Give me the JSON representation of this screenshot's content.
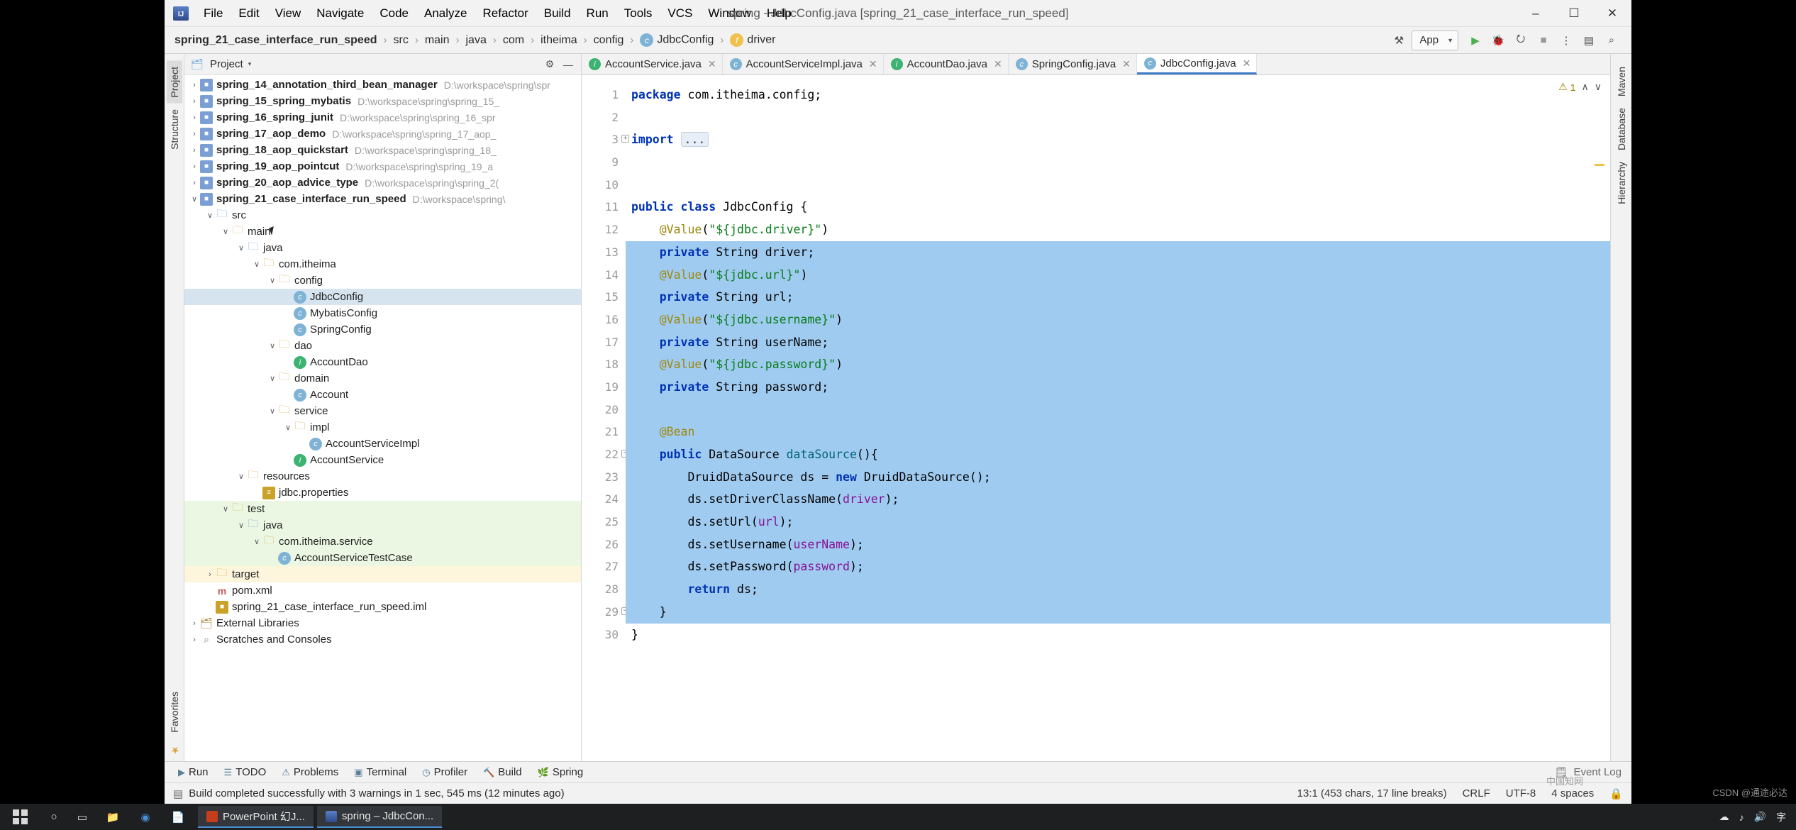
{
  "window": {
    "title": "spring - JdbcConfig.java [spring_21_case_interface_run_speed]",
    "minimize": "–",
    "maximize": "☐",
    "close": "✕"
  },
  "menu": {
    "logo": "IJ",
    "items": [
      "File",
      "Edit",
      "View",
      "Navigate",
      "Code",
      "Analyze",
      "Refactor",
      "Build",
      "Run",
      "Tools",
      "VCS",
      "Window",
      "Help"
    ]
  },
  "breadcrumb": {
    "items": [
      {
        "label": "spring_21_case_interface_run_speed",
        "bold": true,
        "icon": ""
      },
      {
        "label": "src",
        "bold": false,
        "icon": ""
      },
      {
        "label": "main",
        "bold": false,
        "icon": ""
      },
      {
        "label": "java",
        "bold": false,
        "icon": ""
      },
      {
        "label": "com",
        "bold": false,
        "icon": ""
      },
      {
        "label": "itheima",
        "bold": false,
        "icon": ""
      },
      {
        "label": "config",
        "bold": false,
        "icon": ""
      },
      {
        "label": "JdbcConfig",
        "bold": false,
        "icon": "c"
      },
      {
        "label": "driver",
        "bold": false,
        "icon": "f"
      }
    ],
    "separator": "›"
  },
  "toolbar": {
    "build_icon": "⚒",
    "run_config": "App",
    "run_config_caret": "▼",
    "run_icon": "▶",
    "debug_icon": "🐞",
    "coverage_icon": "⭮",
    "stop_icon": "■",
    "more_icon": "⋮",
    "layout_icon": "▤",
    "search_icon": "⌕"
  },
  "project_panel": {
    "header_title": "Project",
    "header_caret": "▾",
    "header_icons": [
      "⚙",
      "—"
    ],
    "tree": [
      {
        "indent": 0,
        "arrow": "›",
        "icon": "mod",
        "icon_char": "■",
        "label": "spring_14_annotation_third_bean_manager",
        "dim": "D:\\workspace\\spring\\spr",
        "bold": true,
        "clipped": true
      },
      {
        "indent": 0,
        "arrow": "›",
        "icon": "mod",
        "icon_char": "■",
        "label": "spring_15_spring_mybatis",
        "dim": "D:\\workspace\\spring\\spring_15_",
        "bold": true
      },
      {
        "indent": 0,
        "arrow": "›",
        "icon": "mod",
        "icon_char": "■",
        "label": "spring_16_spring_junit",
        "dim": "D:\\workspace\\spring\\spring_16_spr",
        "bold": true
      },
      {
        "indent": 0,
        "arrow": "›",
        "icon": "mod",
        "icon_char": "■",
        "label": "spring_17_aop_demo",
        "dim": "D:\\workspace\\spring\\spring_17_aop_",
        "bold": true
      },
      {
        "indent": 0,
        "arrow": "›",
        "icon": "mod",
        "icon_char": "■",
        "label": "spring_18_aop_quickstart",
        "dim": "D:\\workspace\\spring\\spring_18_",
        "bold": true
      },
      {
        "indent": 0,
        "arrow": "›",
        "icon": "mod",
        "icon_char": "■",
        "label": "spring_19_aop_pointcut",
        "dim": "D:\\workspace\\spring\\spring_19_a",
        "bold": true
      },
      {
        "indent": 0,
        "arrow": "›",
        "icon": "mod",
        "icon_char": "■",
        "label": "spring_20_aop_advice_type",
        "dim": "D:\\workspace\\spring\\spring_2(",
        "bold": true
      },
      {
        "indent": 0,
        "arrow": "∨",
        "icon": "mod",
        "icon_char": "■",
        "label": "spring_21_case_interface_run_speed",
        "dim": "D:\\workspace\\spring\\",
        "bold": true
      },
      {
        "indent": 1,
        "arrow": "∨",
        "icon": "folderblue",
        "icon_char": "🗀",
        "label": "src",
        "dim": "",
        "bold": false
      },
      {
        "indent": 2,
        "arrow": "∨",
        "icon": "folder",
        "icon_char": "🗀",
        "label": "main",
        "dim": "",
        "bold": false
      },
      {
        "indent": 3,
        "arrow": "∨",
        "icon": "folderblue",
        "icon_char": "🗀",
        "label": "java",
        "dim": "",
        "bold": false
      },
      {
        "indent": 4,
        "arrow": "∨",
        "icon": "folder",
        "icon_char": "🗀",
        "label": "com.itheima",
        "dim": "",
        "bold": false
      },
      {
        "indent": 5,
        "arrow": "∨",
        "icon": "folder",
        "icon_char": "🗀",
        "label": "config",
        "dim": "",
        "bold": false
      },
      {
        "indent": 6,
        "arrow": "",
        "icon": "cls",
        "icon_char": "c",
        "label": "JdbcConfig",
        "dim": "",
        "bold": false,
        "selected": true
      },
      {
        "indent": 6,
        "arrow": "",
        "icon": "cls",
        "icon_char": "c",
        "label": "MybatisConfig",
        "dim": "",
        "bold": false
      },
      {
        "indent": 6,
        "arrow": "",
        "icon": "cls",
        "icon_char": "c",
        "label": "SpringConfig",
        "dim": "",
        "bold": false
      },
      {
        "indent": 5,
        "arrow": "∨",
        "icon": "folder",
        "icon_char": "🗀",
        "label": "dao",
        "dim": "",
        "bold": false
      },
      {
        "indent": 6,
        "arrow": "",
        "icon": "iface",
        "icon_char": "i",
        "label": "AccountDao",
        "dim": "",
        "bold": false
      },
      {
        "indent": 5,
        "arrow": "∨",
        "icon": "folder",
        "icon_char": "🗀",
        "label": "domain",
        "dim": "",
        "bold": false
      },
      {
        "indent": 6,
        "arrow": "",
        "icon": "cls",
        "icon_char": "c",
        "label": "Account",
        "dim": "",
        "bold": false
      },
      {
        "indent": 5,
        "arrow": "∨",
        "icon": "folder",
        "icon_char": "🗀",
        "label": "service",
        "dim": "",
        "bold": false
      },
      {
        "indent": 6,
        "arrow": "∨",
        "icon": "folder",
        "icon_char": "🗀",
        "label": "impl",
        "dim": "",
        "bold": false
      },
      {
        "indent": 7,
        "arrow": "",
        "icon": "cls",
        "icon_char": "c",
        "label": "AccountServiceImpl",
        "dim": "",
        "bold": false
      },
      {
        "indent": 6,
        "arrow": "",
        "icon": "iface",
        "icon_char": "i",
        "label": "AccountService",
        "dim": "",
        "bold": false
      },
      {
        "indent": 3,
        "arrow": "∨",
        "icon": "folder",
        "icon_char": "🗀",
        "label": "resources",
        "dim": "",
        "bold": false
      },
      {
        "indent": 4,
        "arrow": "",
        "icon": "prop",
        "icon_char": "≡",
        "label": "jdbc.properties",
        "dim": "",
        "bold": false
      },
      {
        "indent": 2,
        "arrow": "∨",
        "icon": "folder",
        "icon_char": "🗀",
        "label": "test",
        "dim": "",
        "bold": false,
        "green": true
      },
      {
        "indent": 3,
        "arrow": "∨",
        "icon": "folderblue",
        "icon_char": "🗀",
        "label": "java",
        "dim": "",
        "bold": false,
        "green": true
      },
      {
        "indent": 4,
        "arrow": "∨",
        "icon": "folder",
        "icon_char": "🗀",
        "label": "com.itheima.service",
        "dim": "",
        "bold": false,
        "green": true
      },
      {
        "indent": 5,
        "arrow": "",
        "icon": "cls",
        "icon_char": "c",
        "label": "AccountServiceTestCase",
        "dim": "",
        "bold": false,
        "green": true
      },
      {
        "indent": 1,
        "arrow": "›",
        "icon": "folder",
        "icon_char": "🗀",
        "label": "target",
        "dim": "",
        "bold": false,
        "yellow": true
      },
      {
        "indent": 1,
        "arrow": "",
        "icon": "xml",
        "icon_char": "m",
        "label": "pom.xml",
        "dim": "",
        "bold": false
      },
      {
        "indent": 1,
        "arrow": "",
        "icon": "prop",
        "icon_char": "■",
        "label": "spring_21_case_interface_run_speed.iml",
        "dim": "",
        "bold": false
      },
      {
        "indent": 0,
        "arrow": "›",
        "icon": "lib",
        "icon_char": "🗂",
        "label": "External Libraries",
        "dim": "",
        "bold": false
      },
      {
        "indent": 0,
        "arrow": "›",
        "icon": "scr",
        "icon_char": "⌕",
        "label": "Scratches and Consoles",
        "dim": "",
        "bold": false
      }
    ]
  },
  "left_strip": {
    "tabs": [
      "Project",
      "Structure",
      "Favorites"
    ],
    "star_icon": "★"
  },
  "right_strip": {
    "tabs": [
      "Maven",
      "Database",
      "Hierarchy"
    ]
  },
  "editor_tabs": [
    {
      "label": "AccountService.java",
      "icon": "i",
      "active": false
    },
    {
      "label": "AccountServiceImpl.java",
      "icon": "c",
      "active": false
    },
    {
      "label": "AccountDao.java",
      "icon": "i",
      "active": false
    },
    {
      "label": "SpringConfig.java",
      "icon": "c",
      "active": false
    },
    {
      "label": "JdbcConfig.java",
      "icon": "c",
      "active": true
    }
  ],
  "editor_tab_close": "✕",
  "inspection": {
    "warning_icon": "⚠",
    "warning_count": "1",
    "up_arrow": "∧",
    "down_arrow": "∨"
  },
  "code": {
    "lines": [
      {
        "n": "1",
        "sel": false,
        "html": "<span class=\"kw\">package</span> com.itheima.config;"
      },
      {
        "n": "2",
        "sel": false,
        "html": ""
      },
      {
        "n": "3",
        "sel": false,
        "fold": true,
        "html": "<span class=\"kw\">import</span> <span class=\"folded\">...</span>"
      },
      {
        "n": "9",
        "sel": false,
        "html": ""
      },
      {
        "n": "10",
        "sel": false,
        "html": ""
      },
      {
        "n": "11",
        "sel": false,
        "html": "<span class=\"kw\">public class</span> JdbcConfig {"
      },
      {
        "n": "12",
        "sel": false,
        "html": "    <span class=\"ann\">@Value</span>(<span class=\"str\">\"${jdbc.driver}\"</span>)"
      },
      {
        "n": "13",
        "sel": true,
        "html": "    <span class=\"kw\">private</span> String driver;"
      },
      {
        "n": "14",
        "sel": true,
        "html": "    <span class=\"ann\">@Value</span>(<span class=\"str\">\"${jdbc.url}\"</span>)"
      },
      {
        "n": "15",
        "sel": true,
        "html": "    <span class=\"kw\">private</span> String url;"
      },
      {
        "n": "16",
        "sel": true,
        "html": "    <span class=\"ann\">@Value</span>(<span class=\"str\">\"${jdbc.username}\"</span>)"
      },
      {
        "n": "17",
        "sel": true,
        "html": "    <span class=\"kw\">private</span> String userName;"
      },
      {
        "n": "18",
        "sel": true,
        "html": "    <span class=\"ann\">@Value</span>(<span class=\"str\">\"${jdbc.password}\"</span>)"
      },
      {
        "n": "19",
        "sel": true,
        "html": "    <span class=\"kw\">private</span> String password;"
      },
      {
        "n": "20",
        "sel": true,
        "html": ""
      },
      {
        "n": "21",
        "sel": true,
        "bean": true,
        "html": "    <span class=\"ann\">@Bean</span>"
      },
      {
        "n": "22",
        "sel": true,
        "fold2": true,
        "html": "    <span class=\"kw\">public</span> DataSource <span class=\"mtd\">dataSource</span>(){"
      },
      {
        "n": "23",
        "sel": true,
        "html": "        DruidDataSource ds = <span class=\"kw\">new</span> DruidDataSource();"
      },
      {
        "n": "24",
        "sel": true,
        "html": "        ds.setDriverClassName(<span class=\"fld\">driver</span>);"
      },
      {
        "n": "25",
        "sel": true,
        "html": "        ds.setUrl(<span class=\"fld\">url</span>);"
      },
      {
        "n": "26",
        "sel": true,
        "html": "        ds.setUsername(<span class=\"fld\">userName</span>);"
      },
      {
        "n": "27",
        "sel": true,
        "html": "        ds.setPassword(<span class=\"fld\">password</span>);"
      },
      {
        "n": "28",
        "sel": true,
        "html": "        <span class=\"kw\">return</span> ds;"
      },
      {
        "n": "29",
        "sel": true,
        "fold3": true,
        "html": "    }"
      },
      {
        "n": "30",
        "sel": false,
        "html": "}"
      }
    ]
  },
  "bottom_bar": {
    "tabs": [
      {
        "icon": "▶",
        "label": "Run"
      },
      {
        "icon": "☰",
        "label": "TODO"
      },
      {
        "icon": "⚠",
        "label": "Problems"
      },
      {
        "icon": "▣",
        "label": "Terminal"
      },
      {
        "icon": "◷",
        "label": "Profiler"
      },
      {
        "icon": "🔨",
        "label": "Build"
      },
      {
        "icon": "🌿",
        "label": "Spring"
      }
    ],
    "event_log": "Event Log",
    "event_log_icon": "🗒"
  },
  "status_bar": {
    "icon": "▤",
    "message": "Build completed successfully with 3 warnings in 1 sec, 545 ms (12 minutes ago)",
    "position": "13:1 (453 chars, 17 line breaks)",
    "line_sep": "CRLF",
    "encoding": "UTF-8",
    "indent": "4 spaces",
    "lock_icon": "🔒"
  },
  "taskbar": {
    "search_icon": "○",
    "task_icon": "▭",
    "apps": [
      {
        "label": "PowerPoint 幻J...",
        "color": "#c43e1c"
      },
      {
        "label": "spring – JdbcCon...",
        "color": "#4a8fd4"
      }
    ],
    "pinned": [
      "📁",
      "🌐",
      "📄"
    ],
    "tray": [
      "☁",
      "♪",
      "🔊",
      "字"
    ]
  },
  "watermarks": {
    "bottom_right": "CSDN @通途必达",
    "mid": "中国知网"
  }
}
